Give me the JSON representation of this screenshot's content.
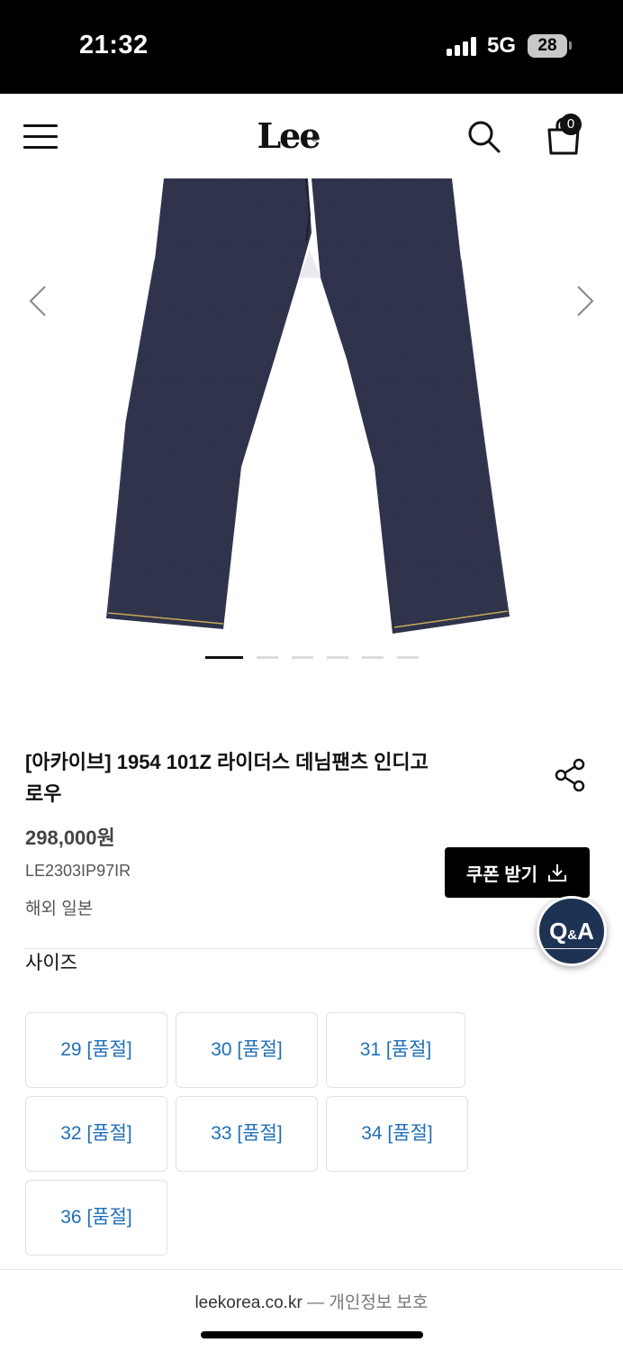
{
  "status_bar": {
    "time": "21:32",
    "network": "5G",
    "battery": "28"
  },
  "header": {
    "logo": "Lee",
    "cart_count": "0"
  },
  "gallery": {
    "slide_count": 6,
    "active_slide": 1
  },
  "product": {
    "title": "[아카이브] 1954 101Z 라이더스 데님팬츠 인디고로우",
    "price": "298,000원",
    "sku": "LE2303IP97IR",
    "origin": "해외 일본"
  },
  "coupon_button": {
    "label": "쿠폰 받기"
  },
  "qa_button": {
    "label_q": "Q",
    "label_amp": "&",
    "label_a": "A"
  },
  "size_section": {
    "label": "사이즈",
    "options": [
      {
        "label": "29 [품절]",
        "sold_out": true
      },
      {
        "label": "30 [품절]",
        "sold_out": true
      },
      {
        "label": "31 [품절]",
        "sold_out": true
      },
      {
        "label": "32 [품절]",
        "sold_out": true
      },
      {
        "label": "33 [품절]",
        "sold_out": true
      },
      {
        "label": "34 [품절]",
        "sold_out": true
      },
      {
        "label": "36 [품절]",
        "sold_out": true
      }
    ]
  },
  "footer": {
    "domain": "leekorea.co.kr",
    "separator": "—",
    "privacy": "개인정보 보호"
  },
  "colors": {
    "accent": "#1f6fb8",
    "qa_bg": "#1e3254",
    "denim": "#2c2f46"
  }
}
